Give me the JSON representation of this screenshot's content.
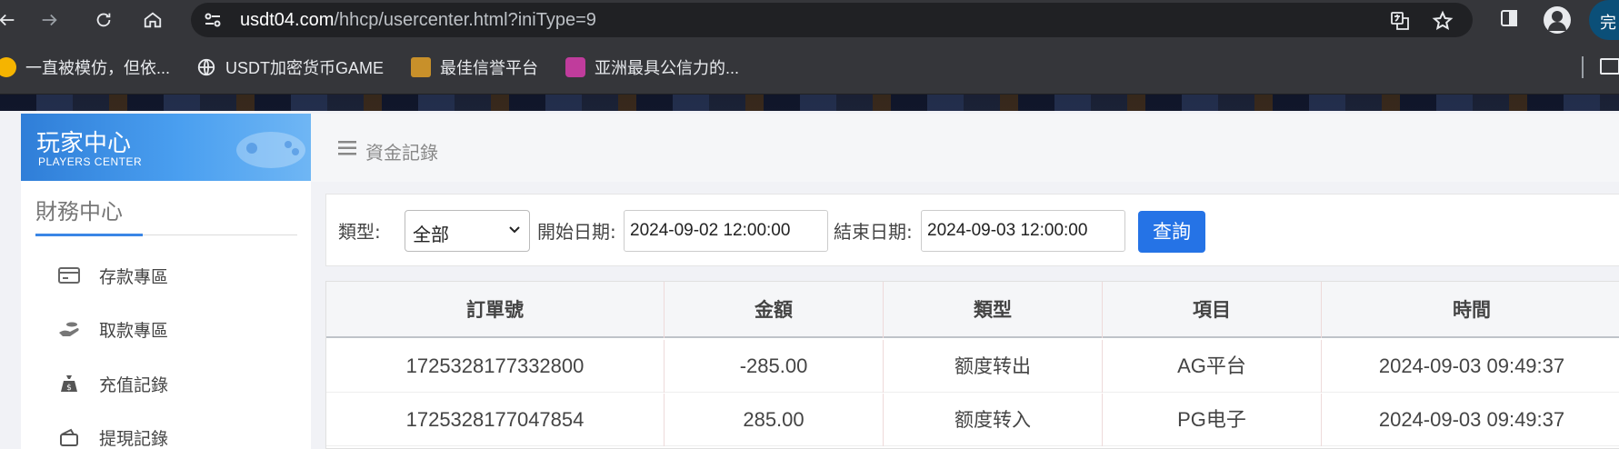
{
  "browser": {
    "url_host": "usdt04.com",
    "url_path": "/hhcp/usercenter.html?iniType=9",
    "profile_label": "完",
    "bookmarks": [
      {
        "label": "一直被模仿，但依..."
      },
      {
        "label": "USDT加密货币GAME"
      },
      {
        "label": "最佳信誉平台"
      },
      {
        "label": "亚洲最具公信力的..."
      }
    ]
  },
  "sidebar": {
    "brand_cn": "玩家中心",
    "brand_en": "PLAYERS CENTER",
    "section_title": "財務中心",
    "items": [
      {
        "label": "存款專區",
        "icon": "card-icon"
      },
      {
        "label": "取款專區",
        "icon": "hand-coin-icon"
      },
      {
        "label": "充值記錄",
        "icon": "money-bag-icon"
      },
      {
        "label": "提現記錄",
        "icon": "wallet-icon"
      }
    ]
  },
  "header": {
    "breadcrumb": "資金記錄"
  },
  "filter": {
    "type_label": "類型:",
    "type_value": "全部",
    "start_label": "開始日期:",
    "start_value": "2024-09-02 12:00:00",
    "end_label": "結束日期:",
    "end_value": "2024-09-03 12:00:00",
    "query_label": "查詢"
  },
  "table": {
    "headers": [
      "訂單號",
      "金額",
      "類型",
      "項目",
      "時間"
    ],
    "rows": [
      [
        "1725328177332800",
        "-285.00",
        "额度转出",
        "AG平台",
        "2024-09-03 09:49:37"
      ],
      [
        "1725328177047854",
        "285.00",
        "额度转入",
        "PG电子",
        "2024-09-03 09:49:37"
      ]
    ]
  },
  "colors": {
    "accent": "#2573e6",
    "sidebar_active": "#3a86e6",
    "brand_gradient_start": "#2f7ed8"
  }
}
